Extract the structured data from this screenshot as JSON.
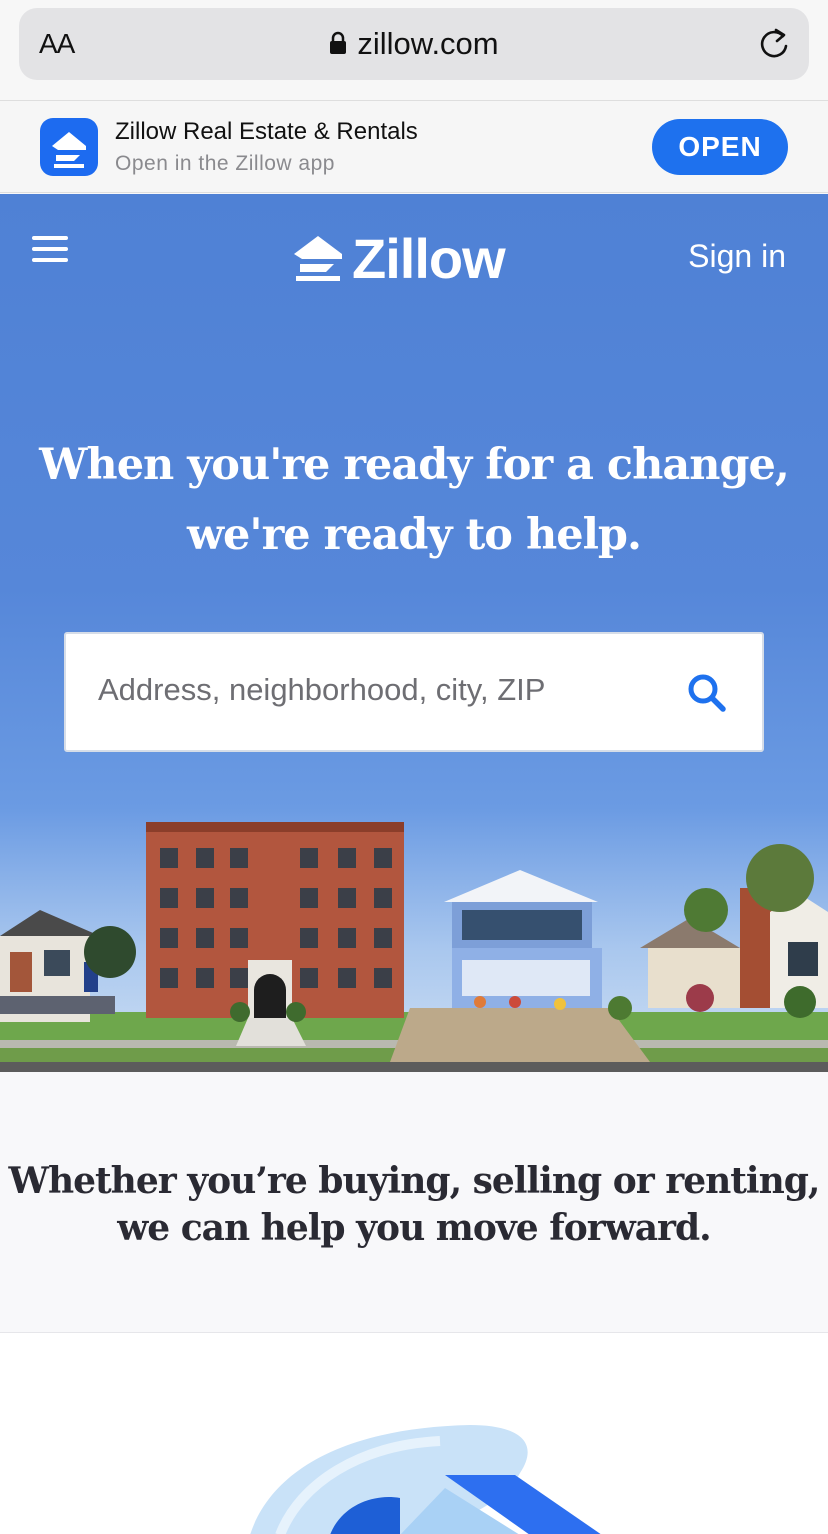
{
  "browser": {
    "text_size_label": "AA",
    "url": "zillow.com"
  },
  "app_banner": {
    "title": "Zillow Real Estate & Rentals",
    "subtitle": "Open in the Zillow app",
    "open_label": "OPEN"
  },
  "header": {
    "logo_text": "Zillow",
    "sign_in_label": "Sign in"
  },
  "hero": {
    "headline_line1": "When you're ready for a change,",
    "headline_line2": "we're ready to help."
  },
  "search": {
    "placeholder": "Address, neighborhood, city, ZIP"
  },
  "section": {
    "tagline_line1": "Whether you’re buying, selling or renting,",
    "tagline_line2": "we can help you move forward."
  },
  "colors": {
    "brand_blue": "#1e71ee",
    "hero_blue": "#4f81d5"
  }
}
